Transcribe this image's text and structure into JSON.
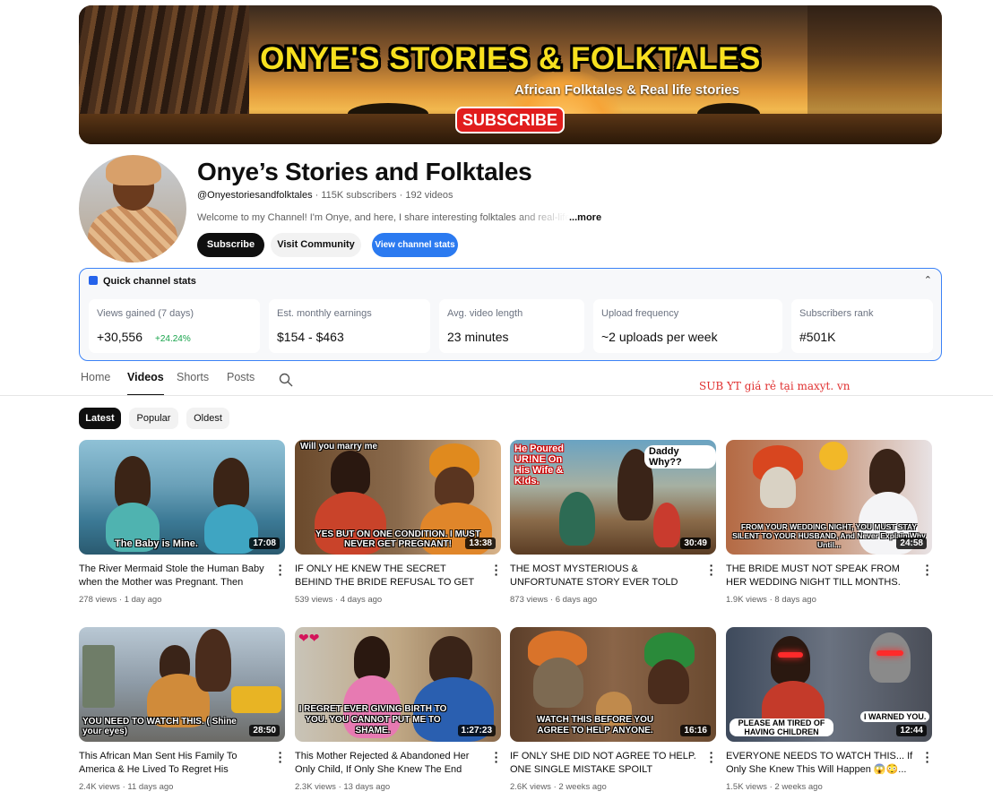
{
  "banner": {
    "title": "ONYE'S STORIES & FOLKTALES",
    "subtitle": "African Folktales & Real life stories",
    "button": "SUBSCRIBE"
  },
  "channel": {
    "name": "Onye’s Stories and Folktales",
    "handle": "@Onyestoriesandfolktales",
    "subscribers": "115K subscribers",
    "videos": "192 videos",
    "description": "Welcome to my Channel! I'm Onye, and here, I share interesting folktales and real-life stories",
    "more": "...more",
    "subscribe_label": "Subscribe",
    "community_label": "Visit Community",
    "stats_label": "View channel stats"
  },
  "stats": {
    "heading": "Quick channel stats",
    "cards": [
      {
        "label": "Views gained (7 days)",
        "value": "+30,556",
        "change": "+24.24%"
      },
      {
        "label": "Est. monthly earnings",
        "value": "$154 - $463"
      },
      {
        "label": "Avg. video length",
        "value": "23 minutes"
      },
      {
        "label": "Upload frequency",
        "value": "~2 uploads per week"
      },
      {
        "label": "Subscribers rank",
        "value": "#501K"
      }
    ]
  },
  "tabs": [
    "Home",
    "Videos",
    "Shorts",
    "Posts"
  ],
  "ad_text": "SUB YT giá rẻ tại maxyt. vn",
  "chips": [
    "Latest",
    "Popular",
    "Oldest"
  ],
  "videos": [
    {
      "title": "The River Mermaid Stole the Human Baby when the Mother was Pregnant. Then This...",
      "views": "278 views",
      "age": "1 day ago",
      "duration": "17:08",
      "overlay": "The Baby is Mine."
    },
    {
      "title": "IF ONLY HE KNEW THE SECRET BEHIND THE BRIDE REFUSAL TO GET PREGNANT AFTE...",
      "views": "539 views",
      "age": "4 days ago",
      "duration": "13:38",
      "overlay": "YES BUT ON ONE CONDITION. I MUST NEVER GET PREGNANT!",
      "tag": "Will you marry me"
    },
    {
      "title": "THE MOST MYSTERIOUS & UNFORTUNATE STORY EVER TOLD ABOUT A FATHER ❤️&...",
      "views": "873 views",
      "age": "6 days ago",
      "duration": "30:49",
      "overlay": "",
      "tag": "He Poured UR!NE On His Wife & K!ds.",
      "tag2": "Daddy Why??"
    },
    {
      "title": "THE BRIDE MUST NOT SPEAK FROM HER WEDDING NIGHT TILL MONTHS. BUT...",
      "views": "1.9K views",
      "age": "8 days ago",
      "duration": "24:58",
      "overlay": "FROM YOUR WEDDING NIGHT, YOU MUST STAY SILENT TO YOUR HUSBAND, And Never Explain Why Until..."
    },
    {
      "title": "This African Man Sent His Family To America & He Lived To Regret His Decision...",
      "views": "2.4K views",
      "age": "11 days ago",
      "duration": "28:50",
      "overlay": "YOU NEED TO WATCH THIS. ( Shine your eyes)"
    },
    {
      "title": "This Mother Rejected & Abandoned Her Only Child, If Only She Knew The End Would Be ...",
      "views": "2.3K views",
      "age": "13 days ago",
      "duration": "1:27:23",
      "overlay": "I REGRET EVER GIVING BIRTH TO YOU. YOU CANNOT PUT ME TO SHAME."
    },
    {
      "title": "IF ONLY SHE DID NOT AGREE TO HELP. ONE SINGLE MISTAKE SPOILT EVERYTHING ......",
      "views": "2.6K views",
      "age": "2 weeks ago",
      "duration": "16:16",
      "overlay": "WATCH THIS BEFORE YOU AGREE TO HELP ANYONE."
    },
    {
      "title": "EVERYONE NEEDS TO WATCH THIS... If Only She Knew This Will Happen 😱😳...",
      "views": "1.5K views",
      "age": "2 weeks ago",
      "duration": "12:44",
      "overlay": "PLEASE AM TIRED OF HAVING CHILDREN",
      "tag": "I WARNED YOU."
    }
  ]
}
